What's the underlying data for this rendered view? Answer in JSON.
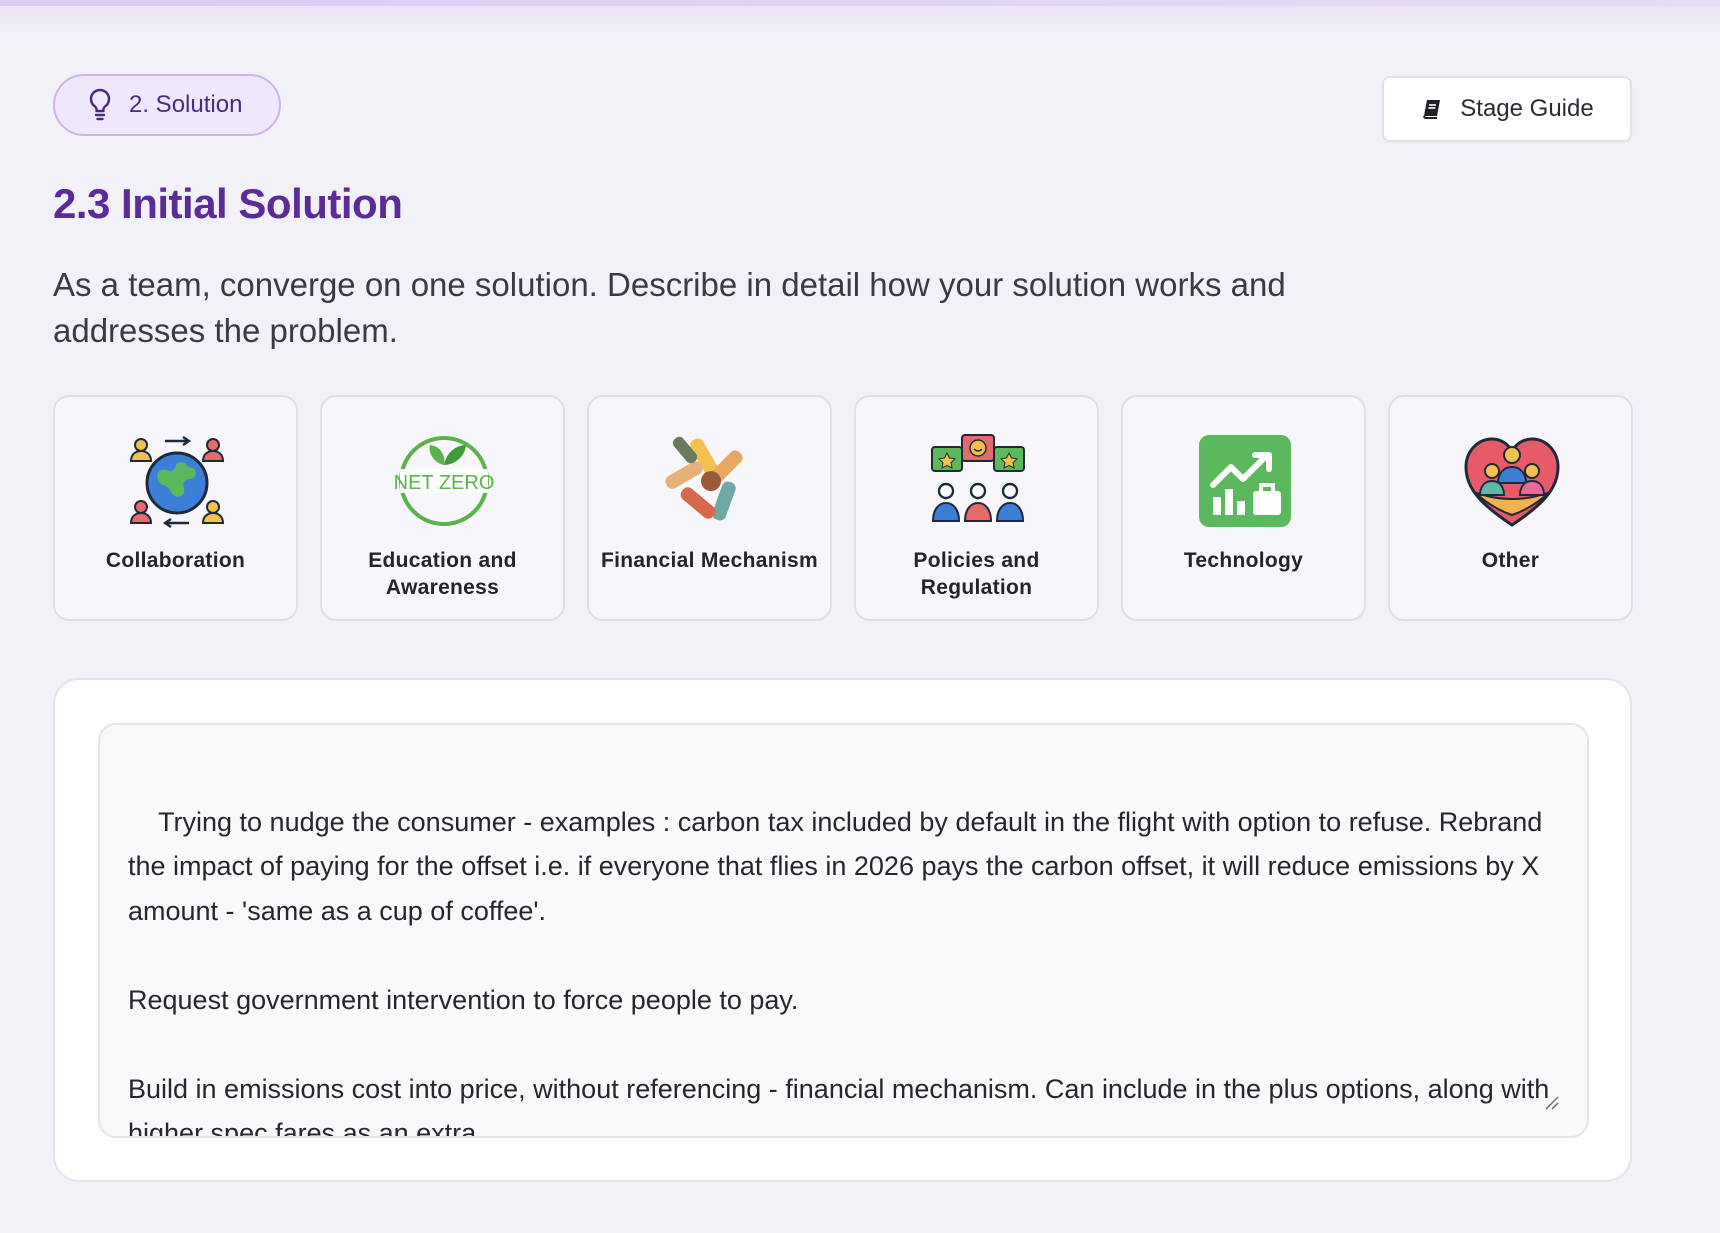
{
  "stage": {
    "label": "2. Solution",
    "icon": "lightbulb-icon"
  },
  "toolbar": {
    "guide_label": "Stage Guide",
    "guide_icon": "book-icon"
  },
  "section": {
    "title": "2.3 Initial Solution",
    "description": "As a team, converge on one solution. Describe in detail how your solution works and addresses the problem."
  },
  "categories": [
    {
      "label": "Collaboration",
      "icon": "globe-people-icon"
    },
    {
      "label": "Education and Awareness",
      "icon": "net-zero-icon"
    },
    {
      "label": "Financial Mechanism",
      "icon": "joined-hands-icon"
    },
    {
      "label": "Policies and Regulation",
      "icon": "people-feedback-icon"
    },
    {
      "label": "Technology",
      "icon": "growth-chart-icon"
    },
    {
      "label": "Other",
      "icon": "heart-family-icon"
    }
  ],
  "answer": {
    "text": "Trying to nudge the consumer - examples : carbon tax included by default in the flight with option to refuse. Rebrand the impact of paying for the offset i.e. if everyone that flies in 2026 pays the carbon offset, it will reduce emissions by X amount - 'same as a cup of coffee'.\n\nRequest government intervention to force people to pay.\n\nBuild in emissions cost into price, without referencing - financial mechanism. Can include in the plus options, along with higher spec fares as an extra."
  },
  "colors": {
    "accent": "#5b2b9a",
    "pill_bg": "#efe7fb",
    "pill_border": "#c9b4ea",
    "net_zero_green": "#5ab34a",
    "technology_green": "#5cb85c"
  }
}
